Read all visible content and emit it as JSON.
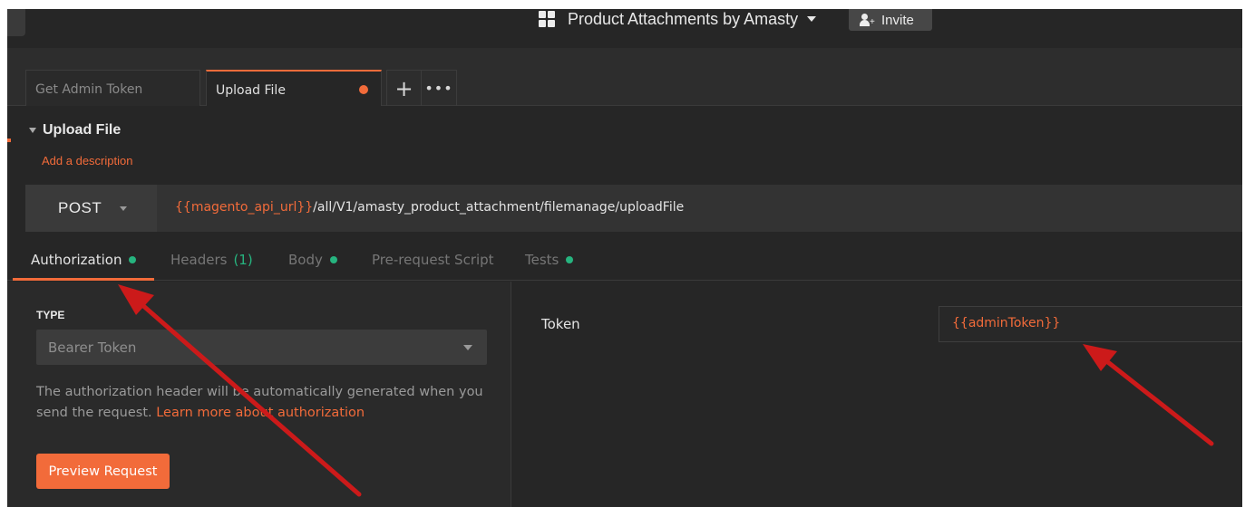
{
  "workspace": {
    "name": "Product Attachments by Amasty",
    "icon": "workspace-grid-icon"
  },
  "invite": {
    "label": "Invite",
    "icon": "add-user-icon"
  },
  "tabs": [
    {
      "label": "Get Admin Token",
      "active": false
    },
    {
      "label": "Upload File",
      "active": true,
      "unsaved": true
    }
  ],
  "tab_actions": {
    "new_tab_icon": "plus-icon",
    "more_icon": "ellipsis-icon"
  },
  "request": {
    "name": "Upload File",
    "add_description": "Add a description",
    "method": "POST",
    "url_variable": "{{magento_api_url}}",
    "url_path": "/all/V1/amasty_product_attachment/filemanage/uploadFile"
  },
  "subtabs": [
    {
      "label": "Authorization",
      "indicator": "dot",
      "active": true
    },
    {
      "label": "Headers",
      "count": "(1)",
      "active": false
    },
    {
      "label": "Body",
      "indicator": "dot",
      "active": false
    },
    {
      "label": "Pre-request Script",
      "active": false
    },
    {
      "label": "Tests",
      "indicator": "dot",
      "active": false
    }
  ],
  "auth": {
    "type_label": "TYPE",
    "type_value": "Bearer Token",
    "description_text": "The authorization header will be automatically generated when you send the request. ",
    "learn_more": "Learn more about authorization",
    "preview_button": "Preview Request",
    "token_label": "Token",
    "token_value": "{{adminToken}}"
  },
  "colors": {
    "accent": "#f26b3a",
    "success_dot": "#26b47f",
    "background": "#262626",
    "annotation_arrow": "#cc1a1a"
  }
}
